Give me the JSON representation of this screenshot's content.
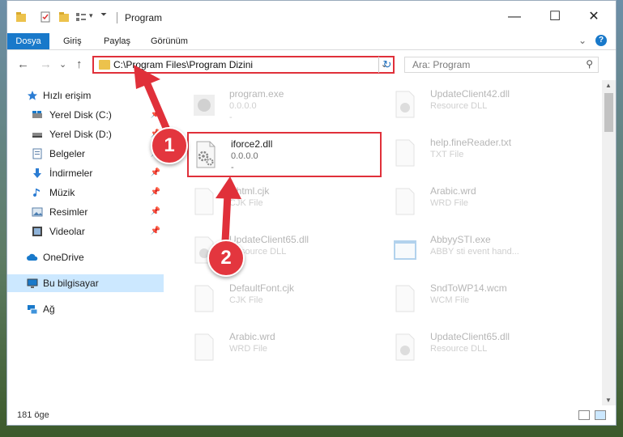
{
  "window": {
    "title": "Program"
  },
  "ribbon": {
    "tabs": [
      "Dosya",
      "Giriş",
      "Paylaş",
      "Görünüm"
    ]
  },
  "address": {
    "path": "C:\\Program Files\\Program Dizini"
  },
  "search": {
    "placeholder": "Ara: Program"
  },
  "sidebar": {
    "items": [
      {
        "label": "Hızlı erişim",
        "icon": "star-icon",
        "pinned": false
      },
      {
        "label": "Yerel Disk (C:)",
        "icon": "drive-icon",
        "pinned": true
      },
      {
        "label": "Yerel Disk (D:)",
        "icon": "drive-icon",
        "pinned": true
      },
      {
        "label": "Belgeler",
        "icon": "documents-icon",
        "pinned": true
      },
      {
        "label": "İndirmeler",
        "icon": "download-icon",
        "pinned": true
      },
      {
        "label": "Müzik",
        "icon": "music-icon",
        "pinned": true
      },
      {
        "label": "Resimler",
        "icon": "pictures-icon",
        "pinned": true
      },
      {
        "label": "Videolar",
        "icon": "video-icon",
        "pinned": true
      },
      {
        "label": "OneDrive",
        "icon": "cloud-icon",
        "pinned": false
      },
      {
        "label": "Bu bilgisayar",
        "icon": "computer-icon",
        "pinned": false,
        "selected": true
      },
      {
        "label": "Ağ",
        "icon": "network-icon",
        "pinned": false
      }
    ]
  },
  "files": [
    {
      "name": "program.exe",
      "line2": "0.0.0.0",
      "line3": "-",
      "icon": "exe-icon"
    },
    {
      "name": "UpdateClient42.dll",
      "line2": "Resource DLL",
      "line3": "",
      "icon": "dll-icon"
    },
    {
      "name": "iforce2.dll",
      "line2": "0.0.0.0",
      "line3": "-",
      "icon": "dll-gear-icon",
      "highlighted": true
    },
    {
      "name": "help.fineReader.txt",
      "line2": "TXT File",
      "line3": "",
      "icon": "file-icon"
    },
    {
      "name": "Hhtml.cjk",
      "line2": "CJK File",
      "line3": "",
      "icon": "file-icon"
    },
    {
      "name": "Arabic.wrd",
      "line2": "WRD File",
      "line3": "",
      "icon": "file-icon"
    },
    {
      "name": "UpdateClient65.dll",
      "line2": "Resource DLL",
      "line3": "",
      "icon": "dll-icon"
    },
    {
      "name": "AbbyySTI.exe",
      "line2": "ABBY sti event hand...",
      "line3": "",
      "icon": "app-icon"
    },
    {
      "name": "DefaultFont.cjk",
      "line2": "CJK File",
      "line3": "",
      "icon": "file-icon"
    },
    {
      "name": "SndToWP14.wcm",
      "line2": "WCM File",
      "line3": "",
      "icon": "file-icon"
    },
    {
      "name": "Arabic.wrd",
      "line2": "WRD File",
      "line3": "",
      "icon": "file-icon"
    },
    {
      "name": "UpdateClient65.dll",
      "line2": "Resource DLL",
      "line3": "",
      "icon": "dll-icon"
    }
  ],
  "status": {
    "count": "181 öge"
  },
  "callouts": [
    "1",
    "2"
  ],
  "colors": {
    "accent": "#1979ca",
    "highlight": "#e0303a",
    "selected": "#cce8ff"
  }
}
